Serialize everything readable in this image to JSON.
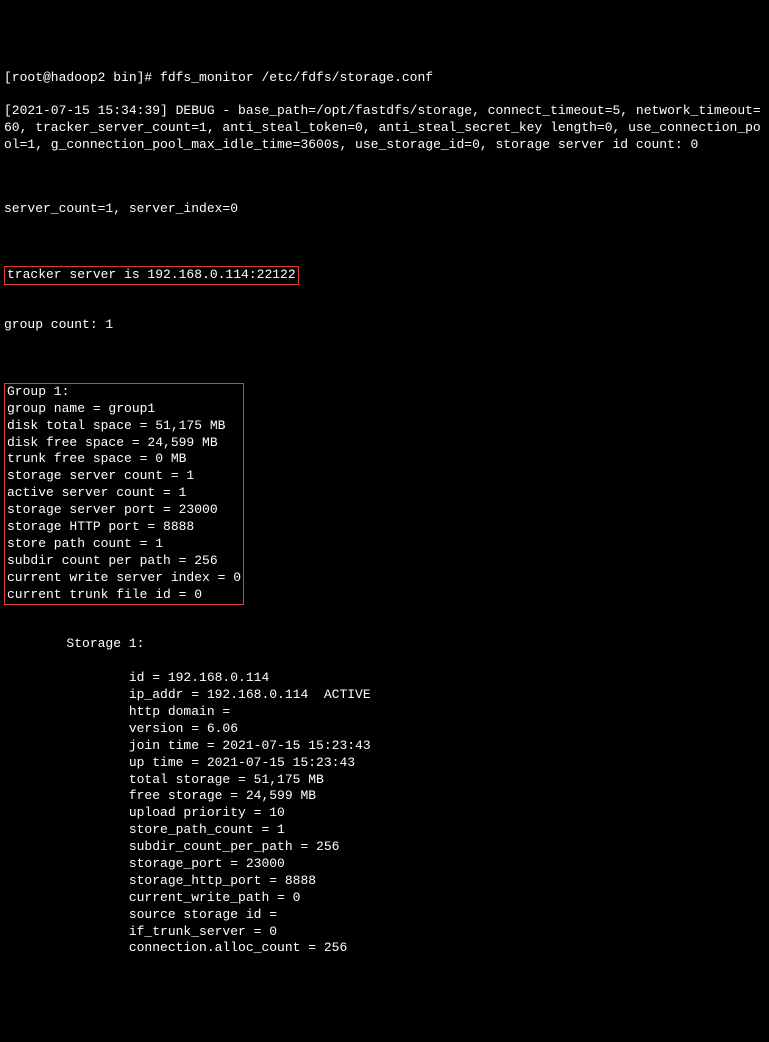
{
  "prompt": "[root@hadoop2 bin]# fdfs_monitor /etc/fdfs/storage.conf",
  "debug_line": "[2021-07-15 15:34:39] DEBUG - base_path=/opt/fastdfs/storage, connect_timeout=5, network_timeout=60, tracker_server_count=1, anti_steal_token=0, anti_steal_secret_key length=0, use_connection_pool=1, g_connection_pool_max_idle_time=3600s, use_storage_id=0, storage server id count: 0",
  "server_line": "server_count=1, server_index=0",
  "tracker_line": "tracker server is 192.168.0.114:22122",
  "group_count": "group count: 1",
  "group_block": "Group 1:\ngroup name = group1\ndisk total space = 51,175 MB\ndisk free space = 24,599 MB\ntrunk free space = 0 MB\nstorage server count = 1\nactive server count = 1\nstorage server port = 23000\nstorage HTTP port = 8888\nstore path count = 1\nsubdir count per path = 256\ncurrent write server index = 0\ncurrent trunk file id = 0",
  "storage_header": "        Storage 1:",
  "storage_lines": [
    "                id = 192.168.0.114",
    "                ip_addr = 192.168.0.114  ACTIVE",
    "                http domain = ",
    "                version = 6.06",
    "                join time = 2021-07-15 15:23:43",
    "                up time = 2021-07-15 15:23:43",
    "                total storage = 51,175 MB",
    "                free storage = 24,599 MB",
    "                upload priority = 10",
    "                store_path_count = 1",
    "                subdir_count_per_path = 256",
    "                storage_port = 23000",
    "                storage_http_port = 8888",
    "                current_write_path = 0",
    "                source storage id = ",
    "                if_trunk_server = 0",
    "                connection.alloc_count = 256"
  ]
}
